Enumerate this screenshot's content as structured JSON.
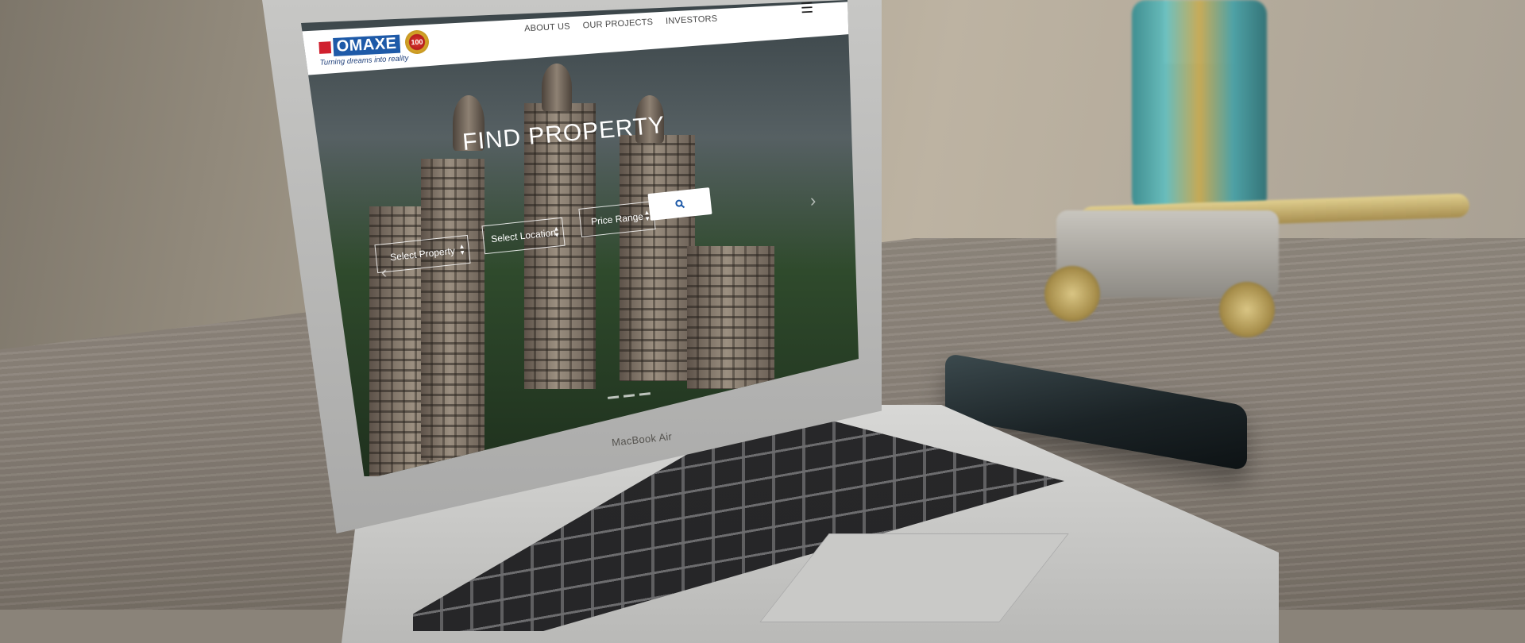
{
  "site": {
    "logo": {
      "name": "OMAXE",
      "tagline": "Turning dreams into reality",
      "badge_text": "100"
    },
    "nav": [
      {
        "label": "ABOUT US"
      },
      {
        "label": "OUR PROJECTS"
      },
      {
        "label": "INVESTORS"
      }
    ],
    "hamburger": "☰",
    "hero": {
      "title": "FIND PROPERTY",
      "fields": [
        {
          "label": "Select Property"
        },
        {
          "label": "Select Location"
        },
        {
          "label": "Price Range"
        }
      ],
      "search_icon": "search-icon",
      "prev_arrow": "‹",
      "next_arrow": "›"
    }
  },
  "device": {
    "label": "MacBook Air"
  },
  "colors": {
    "brand_blue": "#1e5aa8",
    "brand_red": "#d0202e",
    "search_icon": "#1e5aa8"
  }
}
